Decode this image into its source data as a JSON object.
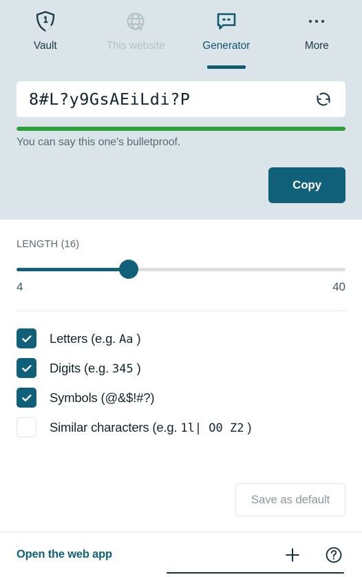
{
  "tabs": [
    {
      "id": "vault",
      "label": "Vault",
      "icon": "shield-icon",
      "state": "normal"
    },
    {
      "id": "this-website",
      "label": "This website",
      "icon": "globe-icon",
      "state": "disabled"
    },
    {
      "id": "generator",
      "label": "Generator",
      "icon": "speech-bubble-icon",
      "state": "active"
    },
    {
      "id": "more",
      "label": "More",
      "icon": "ellipsis-icon",
      "state": "normal"
    }
  ],
  "generator": {
    "password": "8#L?y9GsAEiLdi?P",
    "refresh_icon": "refresh-icon",
    "strength": {
      "percent": 100,
      "color": "#2e9e3e",
      "message": "You can say this one's bulletproof."
    },
    "copy_label": "Copy",
    "copy_color": "#11607a"
  },
  "length": {
    "label": "LENGTH (16)",
    "value": 16,
    "min": 4,
    "max": 40,
    "min_label": "4",
    "max_label": "40",
    "fill_percent": 34
  },
  "options": [
    {
      "id": "letters",
      "checked": true,
      "label": "Letters (e.g. ",
      "example": "Aa",
      "suffix": " )"
    },
    {
      "id": "digits",
      "checked": true,
      "label": "Digits (e.g. ",
      "example": "345",
      "suffix": " )"
    },
    {
      "id": "symbols",
      "checked": true,
      "label": "Symbols (",
      "example": "@&$!#?",
      "suffix": ")"
    },
    {
      "id": "similar",
      "checked": false,
      "label": "Similar characters (e.g. ",
      "example": "1l|  O0  Z2",
      "suffix": " )"
    }
  ],
  "save_default": {
    "label": "Save as default"
  },
  "footer": {
    "link_label": "Open the web app",
    "add_icon": "plus-icon",
    "help_icon": "question-circle-icon"
  },
  "colors": {
    "header_bg": "#dbe5e9",
    "accent": "#11607a",
    "strength_green": "#2e9e3e",
    "disabled_grey": "#b4c2c8"
  }
}
